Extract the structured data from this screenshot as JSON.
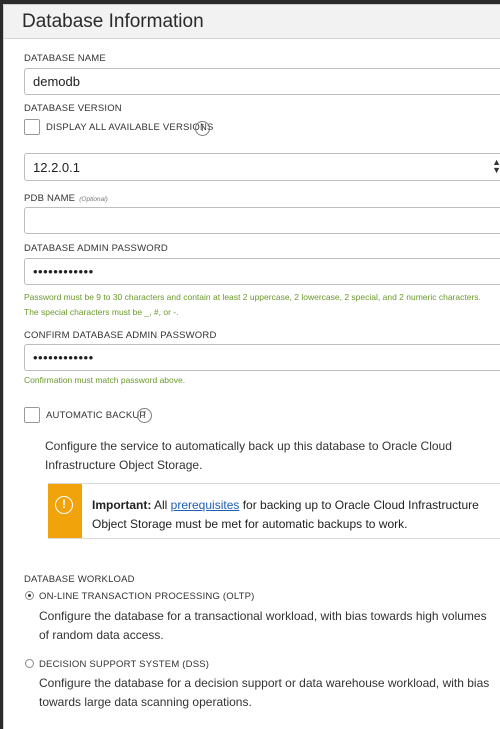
{
  "panel": {
    "title": "Database Information"
  },
  "db_name": {
    "label": "DATABASE NAME",
    "value": "demodb"
  },
  "db_version": {
    "label": "DATABASE VERSION",
    "show_all_label": "DISPLAY ALL AVAILABLE VERSIONS",
    "selected": "12.2.0.1"
  },
  "pdb_name": {
    "label": "PDB NAME",
    "optional": "(Optional)",
    "value": ""
  },
  "admin_password": {
    "label": "DATABASE ADMIN PASSWORD",
    "masked": "••••••••••••",
    "help": "Password must be 9 to 30 characters and contain at least 2 uppercase, 2 lowercase, 2 special, and 2 numeric characters. The special characters must be _, #, or -."
  },
  "confirm_password": {
    "label": "CONFIRM DATABASE ADMIN PASSWORD",
    "masked": "••••••••••••",
    "help": "Confirmation must match password above."
  },
  "auto_backup": {
    "label": "AUTOMATIC BACKUP",
    "description": "Configure the service to automatically back up this database to Oracle Cloud Infrastructure Object Storage."
  },
  "important": {
    "prefix": "Important:",
    "text_before": " All ",
    "link": "prerequisites",
    "text_after": " for backing up to Oracle Cloud Infrastructure Object Storage must be met for automatic backups to work."
  },
  "workload": {
    "label": "DATABASE WORKLOAD",
    "options": [
      {
        "label": "ON-LINE TRANSACTION PROCESSING (OLTP)",
        "description": "Configure the database for a transactional workload, with bias towards high volumes of random data access.",
        "selected": true
      },
      {
        "label": "DECISION SUPPORT SYSTEM (DSS)",
        "description": "Configure the database for a decision support or data warehouse workload, with bias towards large data scanning operations.",
        "selected": false
      }
    ]
  },
  "colors": {
    "accent_warning": "#f0a30a",
    "help_green": "#6a9a2a",
    "link_blue": "#1f5fb5"
  },
  "icons": [
    "info-icon",
    "warning-icon",
    "chevron-updown-icon"
  ]
}
